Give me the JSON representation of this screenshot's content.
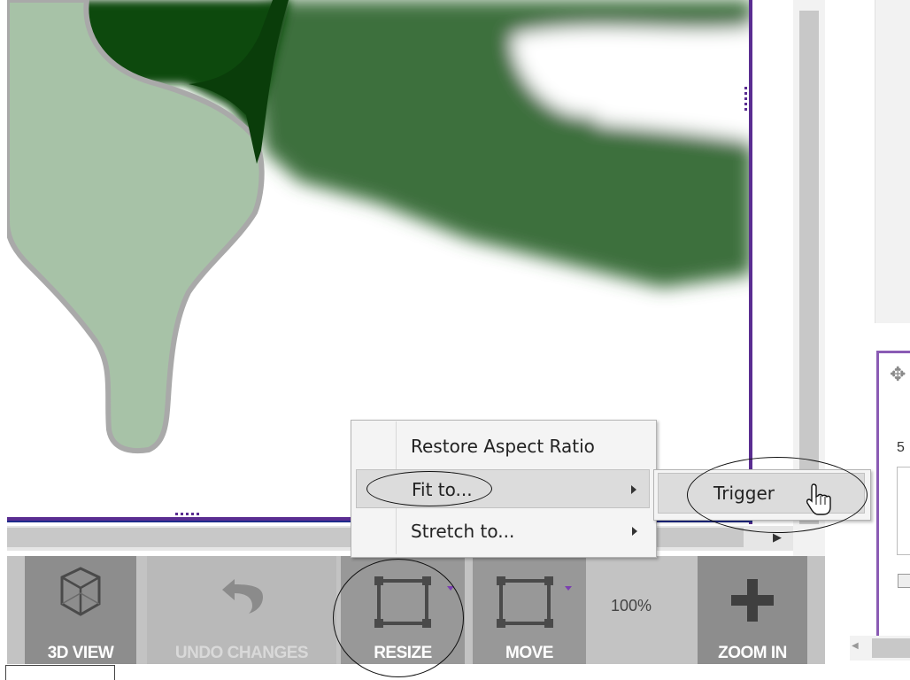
{
  "canvas": {
    "image_description_colors": {
      "light_leaf": "#a7c2a7",
      "dark_green": "#0f4a10",
      "mid_green": "#3a6c3a",
      "outline_gray": "#a9a9a9"
    }
  },
  "toolbar": {
    "view3d_label": "3D VIEW",
    "undo_label": "UNDO CHANGES",
    "resize_label": "RESIZE",
    "move_label": "MOVE",
    "zoom_value": "100%",
    "zoomin_label": "ZOOM IN"
  },
  "context_menu": {
    "items": [
      {
        "label": "Restore Aspect Ratio",
        "has_submenu": false
      },
      {
        "label": "Fit to...",
        "has_submenu": true
      },
      {
        "label": "Stretch to...",
        "has_submenu": true
      }
    ],
    "submenu": {
      "items": [
        {
          "label": "Trigger"
        }
      ]
    }
  },
  "right_panel": {
    "partial_label": "5"
  },
  "icons": {
    "view3d": "cube-icon",
    "undo": "undo-arrow-icon",
    "resize": "resize-frame-icon",
    "move": "move-frame-icon",
    "zoomin": "plus-icon",
    "cursor": "hand-pointer-icon",
    "move_panel": "move-arrows-icon"
  },
  "colors": {
    "accent_purple": "#5a2d91",
    "toolbar_bg": "#c3c3c3",
    "button_bg": "#989898"
  }
}
